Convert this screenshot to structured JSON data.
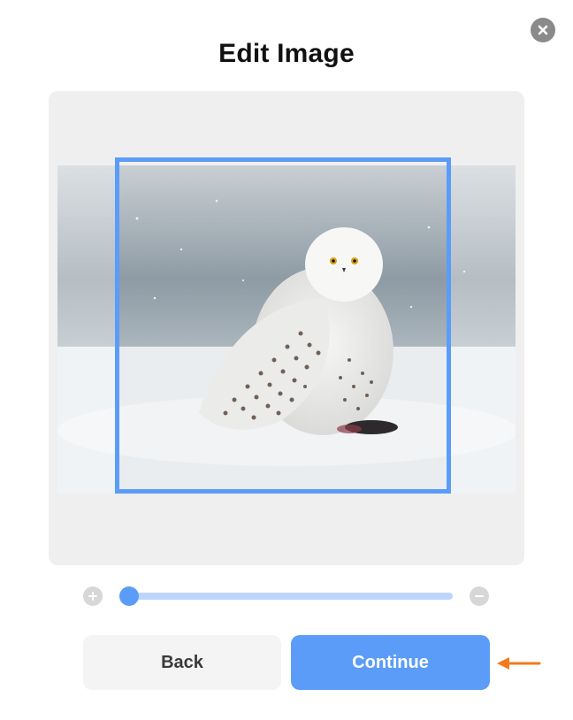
{
  "dialog": {
    "title": "Edit Image",
    "close_icon": "close-icon"
  },
  "editor": {
    "image_subject": "snowy-owl-photo",
    "crop_color": "#5b9cf8",
    "zoom": {
      "level": 0.0,
      "zoom_in_icon": "plus-icon",
      "zoom_out_icon": "minus-icon",
      "track_color": "#bcd6fb",
      "thumb_color": "#5b9cf8"
    }
  },
  "actions": {
    "back_label": "Back",
    "continue_label": "Continue",
    "continue_color": "#5b9cf8",
    "pointer_icon": "arrow-left-icon",
    "pointer_color": "#f07b1e"
  }
}
